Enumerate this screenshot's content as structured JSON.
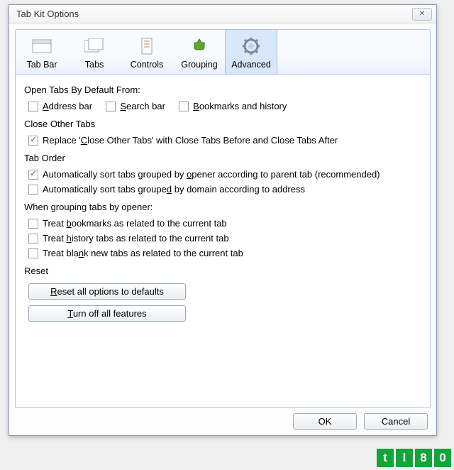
{
  "window": {
    "title": "Tab Kit Options",
    "close_glyph": "✕"
  },
  "tabs": {
    "tab_bar": "Tab Bar",
    "tabs": "Tabs",
    "controls": "Controls",
    "grouping": "Grouping",
    "advanced": "Advanced"
  },
  "sections": {
    "open_tabs_label": "Open Tabs By Default From:",
    "open_tabs": {
      "address_bar": {
        "label_pre": "",
        "u": "A",
        "label_post": "ddress bar",
        "checked": false
      },
      "search_bar": {
        "label_pre": "",
        "u": "S",
        "label_post": "earch bar",
        "checked": false
      },
      "bookmarks": {
        "label_pre": "",
        "u": "B",
        "label_post": "ookmarks and history",
        "checked": false
      }
    },
    "close_other_label": "Close Other Tabs",
    "close_other": {
      "replace": {
        "label_pre": "Replace '",
        "u": "C",
        "label_post": "lose Other Tabs' with Close Tabs Before and Close Tabs After",
        "checked": true
      }
    },
    "tab_order_label": "Tab Order",
    "tab_order": {
      "by_opener": {
        "label_pre": "Automatically sort tabs grouped by ",
        "u": "o",
        "label_post": "pener according to parent tab (recommended)",
        "checked": true
      },
      "by_domain": {
        "label_pre": "Automatically sort tabs groupe",
        "u": "d",
        "label_post": " by domain according to address",
        "checked": false
      }
    },
    "when_grouping_label": "When grouping tabs by opener:",
    "when_grouping": {
      "bookmarks": {
        "label_pre": "Treat ",
        "u": "b",
        "label_post": "ookmarks as related to the current tab",
        "checked": false
      },
      "history": {
        "label_pre": "Treat ",
        "u": "h",
        "label_post": "istory tabs as related to the current tab",
        "checked": false
      },
      "blank": {
        "label_pre": "Treat bla",
        "u": "n",
        "label_post": "k new tabs as related to the current tab",
        "checked": false
      }
    },
    "reset_label": "Reset",
    "reset": {
      "reset_all": {
        "u": "R",
        "label_post": "eset all options to defaults"
      },
      "turn_off": {
        "u": "T",
        "label_post": "urn off all features"
      }
    }
  },
  "footer": {
    "ok": "OK",
    "cancel": "Cancel"
  },
  "watermark": [
    "t",
    "l",
    "8",
    "0"
  ]
}
